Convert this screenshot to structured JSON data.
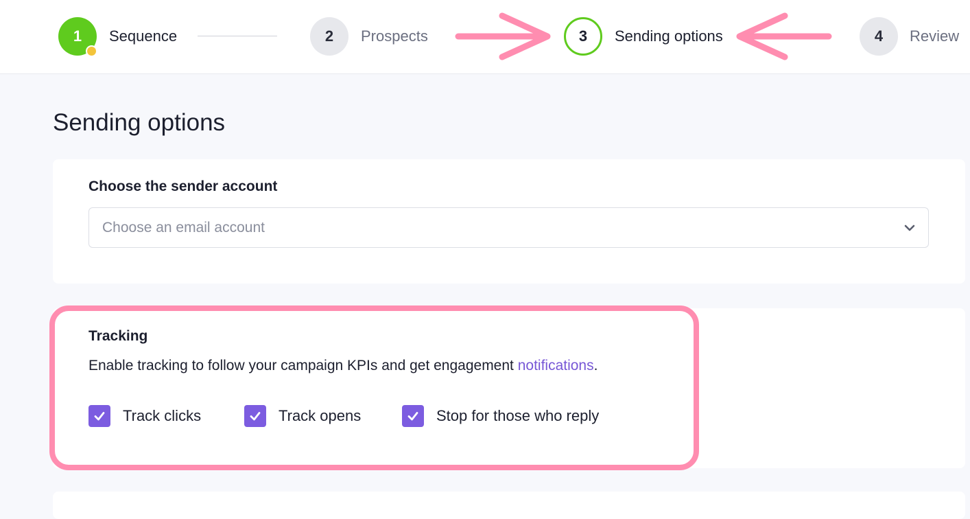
{
  "stepper": {
    "steps": [
      {
        "number": "1",
        "label": "Sequence",
        "state": "done"
      },
      {
        "number": "2",
        "label": "Prospects",
        "state": "idle"
      },
      {
        "number": "3",
        "label": "Sending options",
        "state": "active"
      },
      {
        "number": "4",
        "label": "Review",
        "state": "idle"
      }
    ]
  },
  "page": {
    "title": "Sending options"
  },
  "sender": {
    "heading": "Choose the sender account",
    "select_placeholder": "Choose an email account"
  },
  "tracking": {
    "heading": "Tracking",
    "description_before": "Enable tracking to follow your campaign KPIs and get engagement ",
    "description_link": "notifications",
    "description_after": ".",
    "options": [
      {
        "label": "Track clicks",
        "checked": true
      },
      {
        "label": "Track opens",
        "checked": true
      },
      {
        "label": "Stop for those who reply",
        "checked": true
      }
    ]
  },
  "colors": {
    "step_done": "#5fcb1e",
    "step_badge": "#f3c43b",
    "checkbox": "#7c5ce0",
    "link": "#7757d6",
    "annotation": "#ff8db0"
  },
  "icons": {
    "select_chevron": "chevron-down-icon",
    "checkbox_mark": "checkmark-icon",
    "annotation_arrow_right": "arrow-right-icon",
    "annotation_arrow_left": "arrow-left-icon"
  }
}
